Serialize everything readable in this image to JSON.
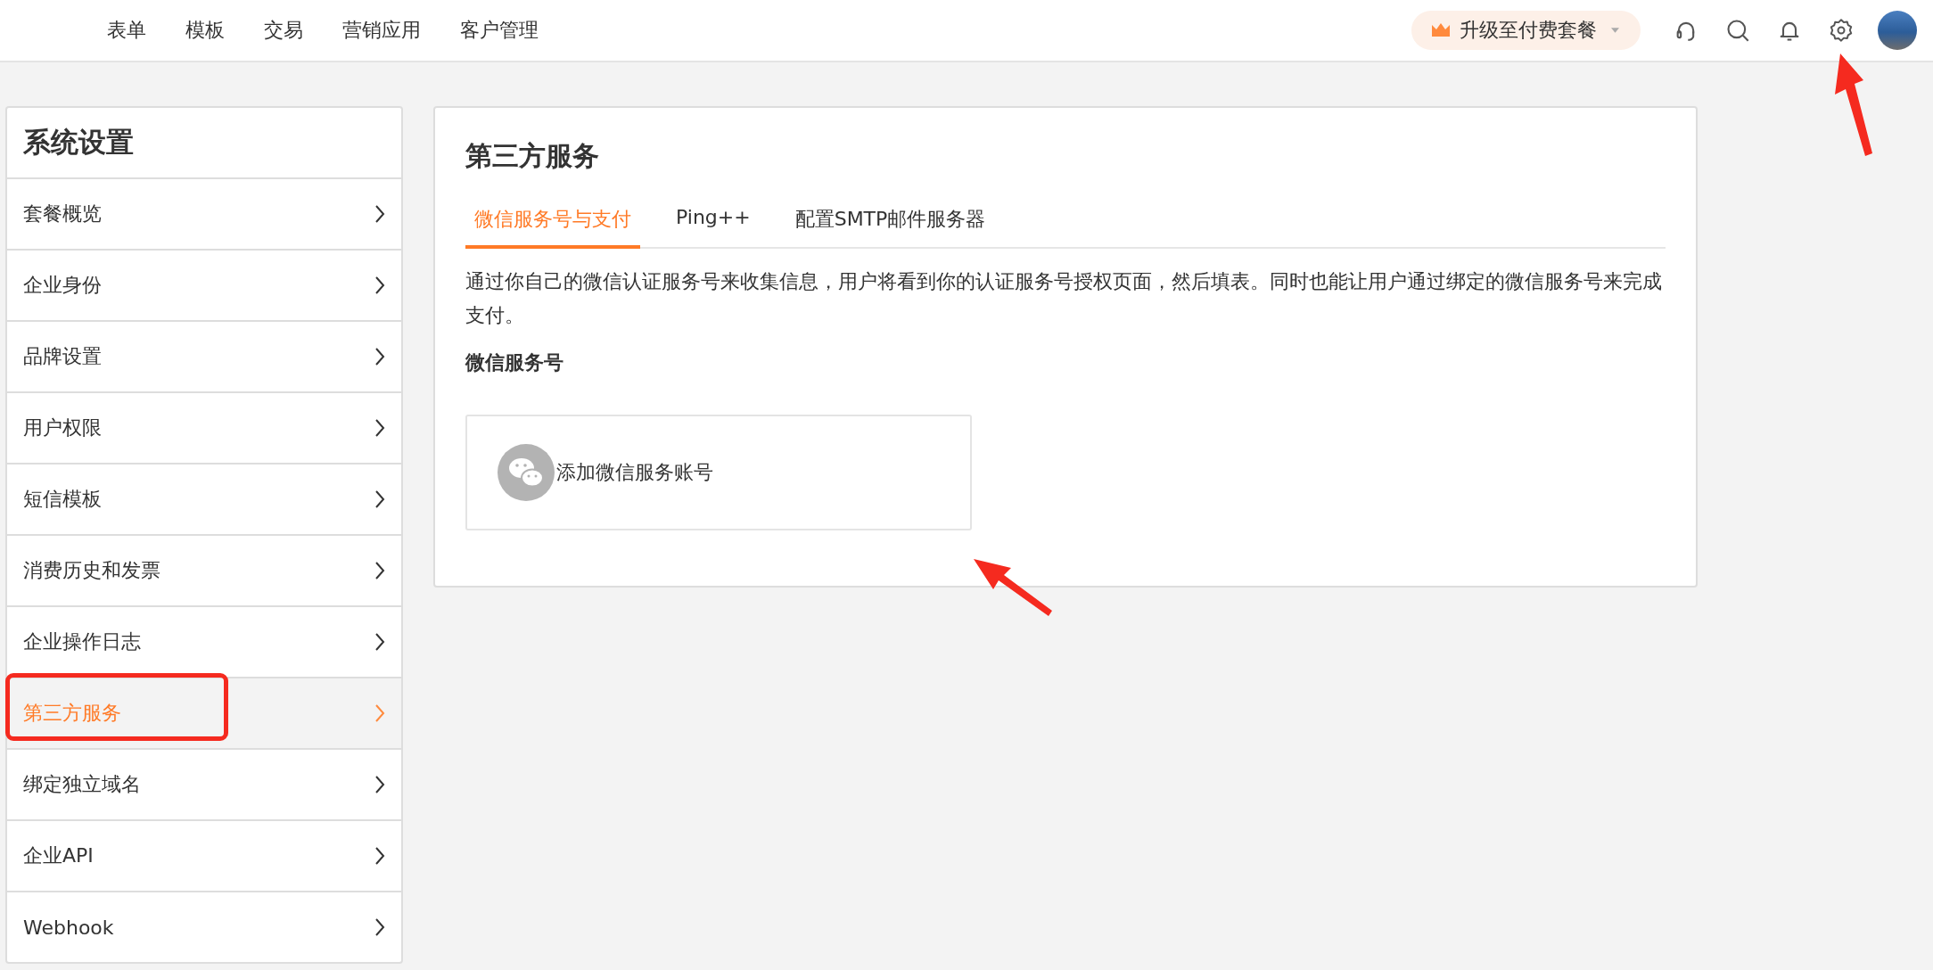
{
  "top_nav": {
    "items": [
      {
        "label": "表单",
        "selected": false
      },
      {
        "label": "模板",
        "selected": false
      },
      {
        "label": "交易",
        "selected": false
      },
      {
        "label": "营销应用",
        "selected": false
      },
      {
        "label": "客户管理",
        "selected": false
      }
    ],
    "upgrade_button": {
      "label": "升级至付费套餐"
    },
    "toolbar_icons": [
      {
        "kind": "headset"
      },
      {
        "kind": "search"
      },
      {
        "kind": "bell"
      },
      {
        "kind": "settings"
      },
      {
        "kind": "avatar"
      }
    ]
  },
  "sidebar": {
    "title": "系统设置",
    "items": [
      {
        "label": "套餐概览",
        "selected": false
      },
      {
        "label": "企业身份",
        "selected": false
      },
      {
        "label": "品牌设置",
        "selected": false
      },
      {
        "label": "用户权限",
        "selected": false
      },
      {
        "label": "短信模板",
        "selected": false
      },
      {
        "label": "消费历史和发票",
        "selected": false
      },
      {
        "label": "企业操作日志",
        "selected": false
      },
      {
        "label": "第三方服务",
        "selected": true
      },
      {
        "label": "绑定独立域名",
        "selected": false
      },
      {
        "label": "企业API",
        "selected": false
      },
      {
        "label": "Webhook",
        "selected": false
      }
    ]
  },
  "panel": {
    "title": "第三方服务",
    "tabs": [
      {
        "label": "微信服务号与支付",
        "selected": true
      },
      {
        "label": "Ping++",
        "selected": false
      },
      {
        "label": "配置SMTP邮件服务器",
        "selected": false
      }
    ],
    "description": "通过你自己的微信认证服务号来收集信息，用户将看到你的认证服务号授权页面，然后填表。同时也能让用户通过绑定的微信服务号来完成支付。",
    "section_title": "微信服务号",
    "add_account_button": {
      "label": "添加微信服务账号"
    }
  },
  "annotations": [
    {
      "kind": "arrow"
    },
    {
      "kind": "arrow"
    },
    {
      "kind": "box"
    }
  ]
}
